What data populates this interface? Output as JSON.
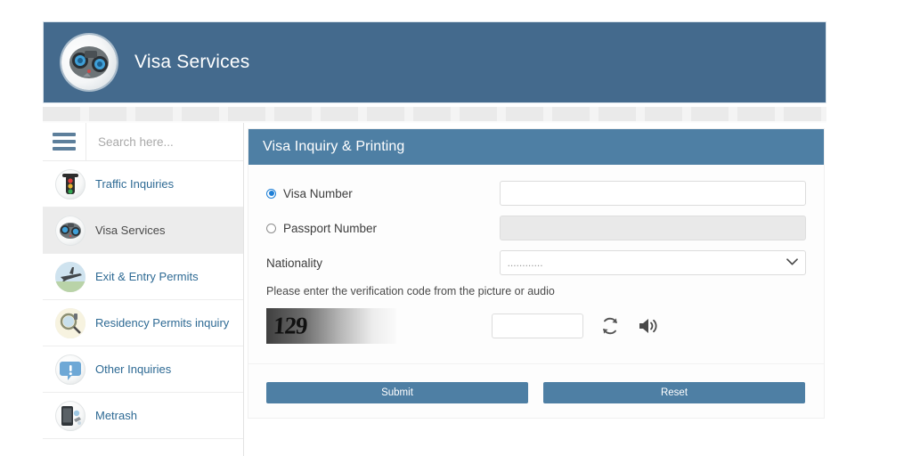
{
  "header": {
    "title": "Visa Services",
    "logo_icon": "globe-camera-logo-icon",
    "bg_color": "#446a8d"
  },
  "sidebar": {
    "menu_icon": "hamburger-menu-icon",
    "search": {
      "placeholder": "Search here...",
      "value": ""
    },
    "items": [
      {
        "label": "Traffic Inquiries",
        "icon": "traffic-light-icon",
        "active": false
      },
      {
        "label": "Visa Services",
        "icon": "globe-camera-icon",
        "active": true
      },
      {
        "label": "Exit & Entry Permits",
        "icon": "airplane-icon",
        "active": false
      },
      {
        "label": "Residency Permits inquiry",
        "icon": "magnifying-glass-icon",
        "active": false
      },
      {
        "label": "Other Inquiries",
        "icon": "exclamation-bubble-icon",
        "active": false
      },
      {
        "label": "Metrash",
        "icon": "mobile-device-icon",
        "active": false
      }
    ]
  },
  "panel": {
    "title": "Visa Inquiry & Printing",
    "header_color": "#4e7fa4",
    "accent_color": "#4e7fa4",
    "link_color": "#2e6a94",
    "radio_checked_color": "#1e7fd6",
    "options": {
      "visa_number": {
        "label": "Visa Number",
        "selected": true,
        "value": "",
        "placeholder": ""
      },
      "passport_number": {
        "label": "Passport Number",
        "selected": false,
        "value": "",
        "placeholder": "",
        "disabled": true
      }
    },
    "nationality": {
      "label": "Nationality",
      "selected": "............",
      "options": [
        "............"
      ]
    },
    "verification": {
      "instruction": "Please enter the verification code from the picture or audio",
      "captcha_text": "129",
      "captcha_input_value": "",
      "refresh_icon": "refresh-icon",
      "audio_icon": "speaker-icon"
    },
    "buttons": {
      "submit": "Submit",
      "reset": "Reset"
    }
  }
}
